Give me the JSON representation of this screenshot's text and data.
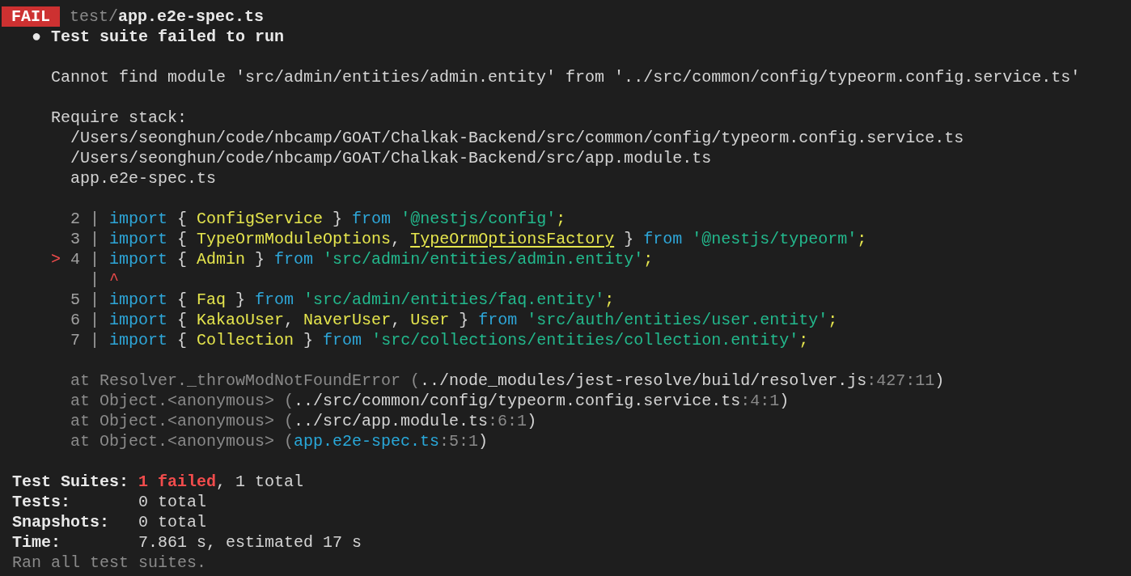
{
  "lines": [
    {
      "kind": "header",
      "badge": "FAIL",
      "segments": [
        {
          "text": "test/",
          "kind": "dim"
        },
        {
          "text": "app.e2e-spec.ts",
          "kind": "bold"
        }
      ]
    },
    {
      "kind": "text",
      "segments": [
        {
          "text": "  ● Test suite failed to run",
          "kind": "bold"
        }
      ]
    },
    {
      "kind": "blank"
    },
    {
      "kind": "text",
      "segments": [
        {
          "text": "    Cannot find module 'src/admin/entities/admin.entity' from '../src/common/config/typeorm.config.service.ts'",
          "kind": "plain"
        }
      ]
    },
    {
      "kind": "blank"
    },
    {
      "kind": "text",
      "segments": [
        {
          "text": "    Require stack:",
          "kind": "plain"
        }
      ]
    },
    {
      "kind": "text",
      "segments": [
        {
          "text": "      /Users/seonghun/code/nbcamp/GOAT/Chalkak-Backend/src/common/config/typeorm.config.service.ts",
          "kind": "plain"
        }
      ]
    },
    {
      "kind": "text",
      "segments": [
        {
          "text": "      /Users/seonghun/code/nbcamp/GOAT/Chalkak-Backend/src/app.module.ts",
          "kind": "plain"
        }
      ]
    },
    {
      "kind": "text",
      "segments": [
        {
          "text": "      app.e2e-spec.ts",
          "kind": "plain"
        }
      ]
    },
    {
      "kind": "blank"
    },
    {
      "kind": "code",
      "segments": [
        {
          "text": "      2 | ",
          "kind": "gutter"
        },
        {
          "text": "import",
          "kind": "keyword"
        },
        {
          "text": " { ",
          "kind": "plain"
        },
        {
          "text": "ConfigService",
          "kind": "ident"
        },
        {
          "text": " } ",
          "kind": "plain"
        },
        {
          "text": "from ",
          "kind": "keyword"
        },
        {
          "text": "'@nestjs/config'",
          "kind": "string"
        },
        {
          "text": ";",
          "kind": "ident"
        }
      ]
    },
    {
      "kind": "code",
      "segments": [
        {
          "text": "      3 | ",
          "kind": "gutter"
        },
        {
          "text": "import",
          "kind": "keyword"
        },
        {
          "text": " { ",
          "kind": "plain"
        },
        {
          "text": "TypeOrmModuleOptions",
          "kind": "ident"
        },
        {
          "text": ", ",
          "kind": "plain"
        },
        {
          "text": "TypeOrmOptionsFactory",
          "kind": "underlined"
        },
        {
          "text": " } ",
          "kind": "plain"
        },
        {
          "text": "from ",
          "kind": "keyword"
        },
        {
          "text": "'@nestjs/typeorm'",
          "kind": "string"
        },
        {
          "text": ";",
          "kind": "ident"
        }
      ]
    },
    {
      "kind": "code",
      "segments": [
        {
          "text": "    > ",
          "kind": "marker"
        },
        {
          "text": "4 | ",
          "kind": "gutter"
        },
        {
          "text": "import",
          "kind": "keyword"
        },
        {
          "text": " { ",
          "kind": "plain"
        },
        {
          "text": "Admin",
          "kind": "ident"
        },
        {
          "text": " } ",
          "kind": "plain"
        },
        {
          "text": "from ",
          "kind": "keyword"
        },
        {
          "text": "'src/admin/entities/admin.entity'",
          "kind": "string"
        },
        {
          "text": ";",
          "kind": "ident"
        }
      ]
    },
    {
      "kind": "code",
      "segments": [
        {
          "text": "        | ",
          "kind": "gutter"
        },
        {
          "text": "^",
          "kind": "marker"
        }
      ]
    },
    {
      "kind": "code",
      "segments": [
        {
          "text": "      5 | ",
          "kind": "gutter"
        },
        {
          "text": "import",
          "kind": "keyword"
        },
        {
          "text": " { ",
          "kind": "plain"
        },
        {
          "text": "Faq",
          "kind": "ident"
        },
        {
          "text": " } ",
          "kind": "plain"
        },
        {
          "text": "from ",
          "kind": "keyword"
        },
        {
          "text": "'src/admin/entities/faq.entity'",
          "kind": "string"
        },
        {
          "text": ";",
          "kind": "ident"
        }
      ]
    },
    {
      "kind": "code",
      "segments": [
        {
          "text": "      6 | ",
          "kind": "gutter"
        },
        {
          "text": "import",
          "kind": "keyword"
        },
        {
          "text": " { ",
          "kind": "plain"
        },
        {
          "text": "KakaoUser",
          "kind": "ident"
        },
        {
          "text": ", ",
          "kind": "plain"
        },
        {
          "text": "NaverUser",
          "kind": "ident"
        },
        {
          "text": ", ",
          "kind": "plain"
        },
        {
          "text": "User",
          "kind": "ident"
        },
        {
          "text": " } ",
          "kind": "plain"
        },
        {
          "text": "from ",
          "kind": "keyword"
        },
        {
          "text": "'src/auth/entities/user.entity'",
          "kind": "string"
        },
        {
          "text": ";",
          "kind": "ident"
        }
      ]
    },
    {
      "kind": "code",
      "segments": [
        {
          "text": "      7 | ",
          "kind": "gutter"
        },
        {
          "text": "import",
          "kind": "keyword"
        },
        {
          "text": " { ",
          "kind": "plain"
        },
        {
          "text": "Collection",
          "kind": "ident"
        },
        {
          "text": " } ",
          "kind": "plain"
        },
        {
          "text": "from ",
          "kind": "keyword"
        },
        {
          "text": "'src/collections/entities/collection.entity'",
          "kind": "string"
        },
        {
          "text": ";",
          "kind": "ident"
        }
      ]
    },
    {
      "kind": "blank"
    },
    {
      "kind": "trace",
      "segments": [
        {
          "text": "      at Resolver._throwModNotFoundError (",
          "kind": "dim"
        },
        {
          "text": "../node_modules/jest-resolve/build/resolver.js",
          "kind": "plain"
        },
        {
          "text": ":427:11",
          "kind": "dim"
        },
        {
          "text": ")",
          "kind": "plain"
        }
      ]
    },
    {
      "kind": "trace",
      "segments": [
        {
          "text": "      at Object.<anonymous> (",
          "kind": "dim"
        },
        {
          "text": "../src/common/config/typeorm.config.service.ts",
          "kind": "plain"
        },
        {
          "text": ":4:1",
          "kind": "dim"
        },
        {
          "text": ")",
          "kind": "plain"
        }
      ]
    },
    {
      "kind": "trace",
      "segments": [
        {
          "text": "      at Object.<anonymous> (",
          "kind": "dim"
        },
        {
          "text": "../src/app.module.ts",
          "kind": "plain"
        },
        {
          "text": ":6:1",
          "kind": "dim"
        },
        {
          "text": ")",
          "kind": "plain"
        }
      ]
    },
    {
      "kind": "trace",
      "segments": [
        {
          "text": "      at Object.<anonymous> (",
          "kind": "dim"
        },
        {
          "text": "app.e2e-spec.ts",
          "kind": "link"
        },
        {
          "text": ":5:1",
          "kind": "dim"
        },
        {
          "text": ")",
          "kind": "plain"
        }
      ]
    },
    {
      "kind": "blank"
    },
    {
      "kind": "summary",
      "segments": [
        {
          "text": "Test Suites: ",
          "kind": "bold"
        },
        {
          "text": "1 failed",
          "kind": "fail"
        },
        {
          "text": ", 1 total",
          "kind": "plain"
        }
      ]
    },
    {
      "kind": "summary",
      "segments": [
        {
          "text": "Tests:",
          "kind": "bold"
        },
        {
          "text": "       0 total",
          "kind": "plain"
        }
      ]
    },
    {
      "kind": "summary",
      "segments": [
        {
          "text": "Snapshots:",
          "kind": "bold"
        },
        {
          "text": "   0 total",
          "kind": "plain"
        }
      ]
    },
    {
      "kind": "summary",
      "segments": [
        {
          "text": "Time:",
          "kind": "bold"
        },
        {
          "text": "        7.861 s, estimated 17 s",
          "kind": "plain"
        }
      ]
    },
    {
      "kind": "summary",
      "segments": [
        {
          "text": "Ran all test suites.",
          "kind": "dim"
        }
      ]
    }
  ]
}
